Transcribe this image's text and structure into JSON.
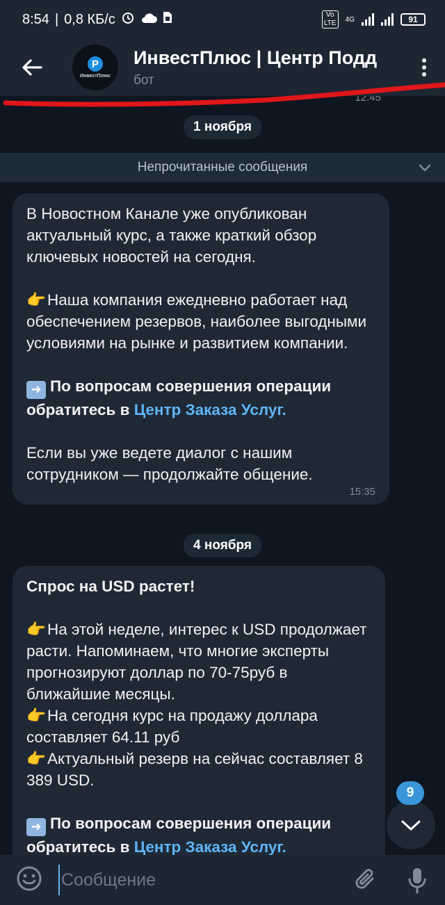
{
  "status_bar": {
    "time": "8:54",
    "speed": "0,8 КБ/с",
    "net_type": "4G",
    "volte": "Vo LTE",
    "battery": "91"
  },
  "header": {
    "title": "ИнвестПлюс | Центр Подд",
    "subtitle": "бот",
    "avatar_text": "ИнвестПлюс",
    "avatar_letter": "P"
  },
  "chat": {
    "previous_time": "12:45",
    "date1": "1 ноября",
    "unread_label": "Непрочитанные сообщения",
    "message1": {
      "p1": "В Новостном Канале уже опубликован актуальный курс, а также краткий обзор ключевых новостей на сегодня.",
      "p2": "Наша компания ежедневно работает над обеспечением резервов, наиболее выгодными условиями на рынке и развитием компании.",
      "p3_bold": "По вопросам совершения операции обратитесь в",
      "p3_link": "Центр Заказа Услуг.",
      "p4": "Если вы уже ведете диалог с нашим сотрудником — продолжайте общение.",
      "time": "15:35"
    },
    "date2": "4 ноября",
    "message2": {
      "title": "Спрос на USD растет!",
      "p1": "На этой неделе, интерес к USD продолжает расти. Напоминаем, что многие эксперты прогнозируют доллар по 70-75руб в ближайшие месяцы.",
      "p2": "На сегодня курс на продажу доллара составляет 64.11 руб",
      "p3": "Актуальный резерв на сейчас составляет 8 389 USD.",
      "p4_bold": "По вопросам совершения операции обратитесь в",
      "p4_link": "Центр Заказа Услуг."
    },
    "unread_count": "9"
  },
  "input": {
    "placeholder": "Сообщение"
  },
  "colors": {
    "accent": "#5eb5f7",
    "bubble": "#1f2936",
    "background": "#0e1621",
    "header": "#1c2733",
    "scribble": "#e0161b"
  },
  "icons": [
    "back-arrow-icon",
    "menu-dots-icon",
    "chevron-down-icon",
    "pointing-hand-icon",
    "right-arrow-icon",
    "emoji-icon",
    "paperclip-icon",
    "microphone-icon",
    "alarm-icon",
    "cloud-icon",
    "sim-icon"
  ]
}
